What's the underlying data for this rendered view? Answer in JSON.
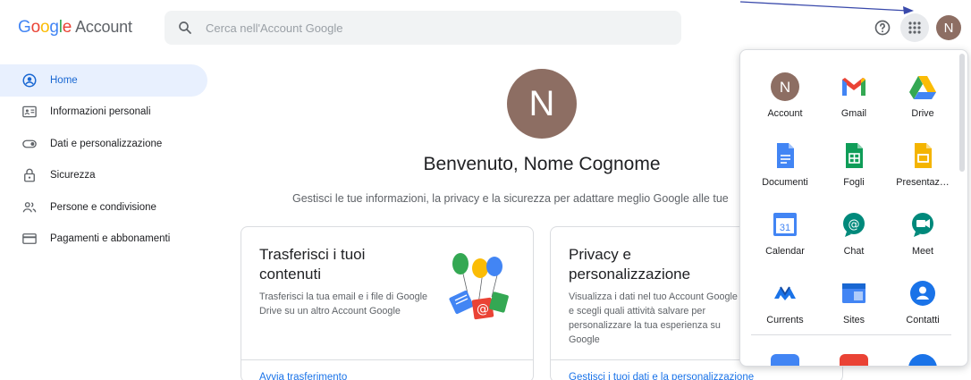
{
  "header": {
    "logo": [
      "G",
      "o",
      "o",
      "g",
      "l",
      "e"
    ],
    "logo_suffix": "Account",
    "search_placeholder": "Cerca nell'Account Google",
    "avatar_initial": "N",
    "icons": [
      "search-icon",
      "help-icon",
      "apps-grid-icon"
    ]
  },
  "sidebar": {
    "items": [
      {
        "label": "Home",
        "icon": "home-icon",
        "active": true
      },
      {
        "label": "Informazioni personali",
        "icon": "id-card-icon"
      },
      {
        "label": "Dati e personalizzazione",
        "icon": "toggle-icon"
      },
      {
        "label": "Sicurezza",
        "icon": "lock-icon"
      },
      {
        "label": "Persone e condivisione",
        "icon": "people-icon"
      },
      {
        "label": "Pagamenti e abbonamenti",
        "icon": "card-icon"
      }
    ]
  },
  "main": {
    "avatar_initial": "N",
    "welcome": "Benvenuto, Nome Cognome",
    "subtitle": "Gestisci le tue informazioni, la privacy e la sicurezza per adattare meglio Google alle tue",
    "cards": [
      {
        "title": "Trasferisci i tuoi contenuti",
        "desc": "Trasferisci la tua email e i file di Google Drive su un altro Account Google",
        "link": "Avvia trasferimento"
      },
      {
        "title": "Privacy e personalizzazione",
        "desc": "Visualizza i dati nel tuo Account Google e scegli quali attività salvare per personalizzare la tua esperienza su Google",
        "link": "Gestisci i tuoi dati e la personalizzazione"
      }
    ]
  },
  "apps_panel": {
    "apps": [
      {
        "label": "Account",
        "icon": "account-icon"
      },
      {
        "label": "Gmail",
        "icon": "gmail-icon"
      },
      {
        "label": "Drive",
        "icon": "drive-icon"
      },
      {
        "label": "Documenti",
        "icon": "docs-icon"
      },
      {
        "label": "Fogli",
        "icon": "sheets-icon"
      },
      {
        "label": "Presentaz…",
        "icon": "slides-icon"
      },
      {
        "label": "Calendar",
        "icon": "calendar-icon"
      },
      {
        "label": "Chat",
        "icon": "chat-icon"
      },
      {
        "label": "Meet",
        "icon": "meet-icon"
      },
      {
        "label": "Currents",
        "icon": "currents-icon"
      },
      {
        "label": "Sites",
        "icon": "sites-icon"
      },
      {
        "label": "Contatti",
        "icon": "contacts-icon"
      }
    ],
    "account_initial": "N",
    "calendar_day": "31"
  },
  "colors": {
    "accent_blue": "#1a73e8",
    "active_bg": "#e8f0fe",
    "avatar_brown": "#8d6e63",
    "annotation_arrow": "#3949ab"
  }
}
